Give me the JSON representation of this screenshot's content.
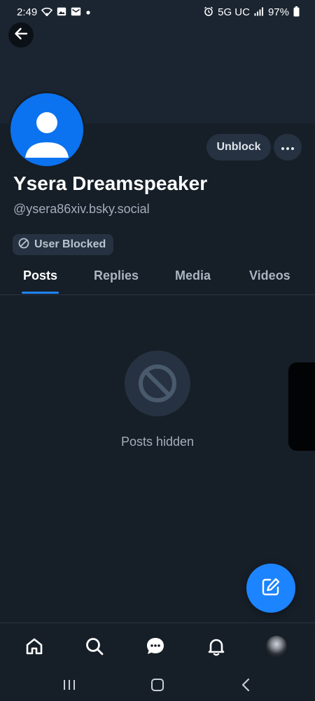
{
  "status_bar": {
    "time": "2:49",
    "network": "5G UC",
    "battery": "97%",
    "left_icons": [
      "wifi-icon",
      "image-icon",
      "mail-icon",
      "dot-icon"
    ],
    "right_icons": [
      "alarm-icon",
      "signal-icon",
      "battery-icon"
    ]
  },
  "profile": {
    "display_name": "Ysera Dreamspeaker",
    "handle": "@ysera86xiv.bsky.social",
    "unblock_label": "Unblock",
    "blocked_badge": "User Blocked"
  },
  "tabs": [
    {
      "label": "Posts",
      "active": true
    },
    {
      "label": "Replies",
      "active": false
    },
    {
      "label": "Media",
      "active": false
    },
    {
      "label": "Videos",
      "active": false
    }
  ],
  "empty_state": {
    "message": "Posts hidden"
  },
  "bottom_nav": [
    "home-icon",
    "search-icon",
    "chat-icon",
    "notifications-icon",
    "profile-avatar"
  ],
  "colors": {
    "accent": "#1d84ff",
    "background": "#161e27",
    "avatar_blue": "#0b72f0"
  }
}
